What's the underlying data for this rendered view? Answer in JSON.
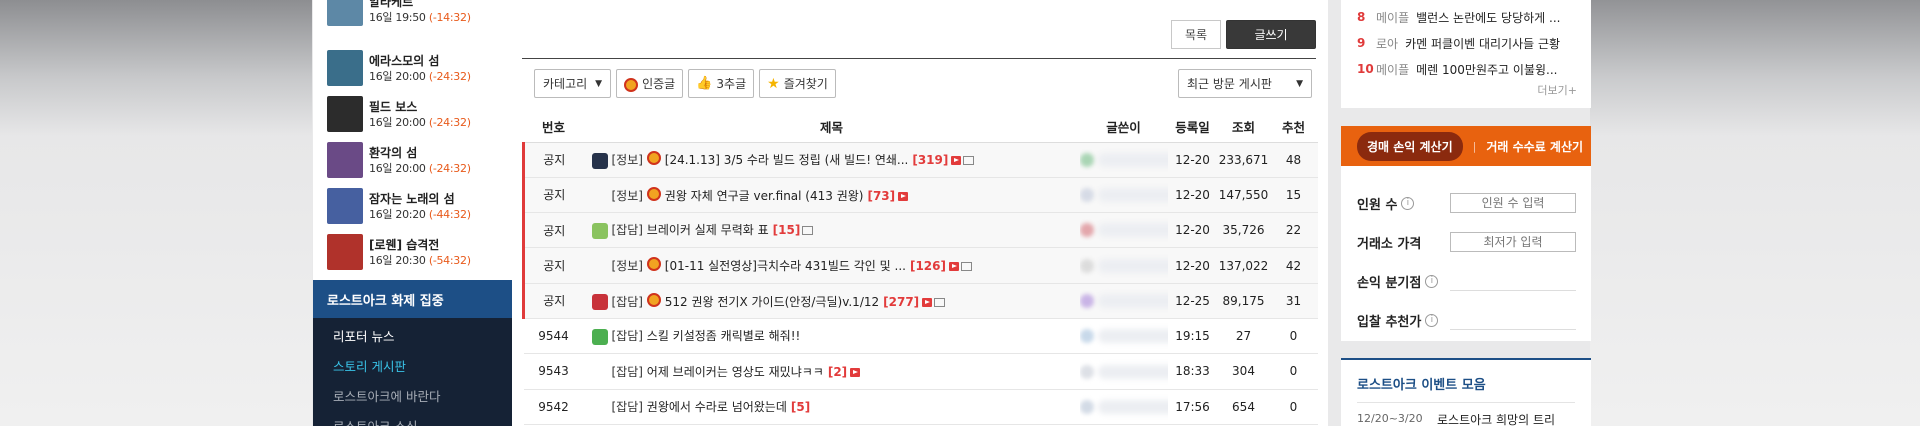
{
  "schedule": [
    {
      "title": "알라케르",
      "time": "16일 19:50",
      "diff": "(-14:32)",
      "color": "#5d88a6"
    },
    {
      "title": "에라스모의 섬",
      "time": "16일 20:00",
      "diff": "(-24:32)",
      "color": "#3a6e8a"
    },
    {
      "title": "필드 보스",
      "time": "16일 20:00",
      "diff": "(-24:32)",
      "color": "#2c2c2c"
    },
    {
      "title": "환각의 섬",
      "time": "16일 20:00",
      "diff": "(-24:32)",
      "color": "#6a4a86"
    },
    {
      "title": "잠자는 노래의 섬",
      "time": "16일 20:20",
      "diff": "(-44:32)",
      "color": "#4660a0"
    },
    {
      "title": "[로웬] 습격전",
      "time": "16일 20:30",
      "diff": "(-54:32)",
      "color": "#b0322b"
    }
  ],
  "topic": {
    "header": "로스트아크 화제 집중",
    "items": [
      "리포터 뉴스",
      "스토리 게시판",
      "로스트아크에 바란다",
      "로스트아크 소식"
    ]
  },
  "board": {
    "list_button": "목록",
    "write_button": "글쓰기",
    "category_select": "카테고리",
    "filter_certified": "인증글",
    "filter_recommend": "3추글",
    "filter_favorite": "즐겨찾기",
    "recent_select": "최근 방문 게시판",
    "columns": [
      "번호",
      "제목",
      "글쓴이",
      "등록일",
      "조회",
      "추천"
    ],
    "rows": [
      {
        "no": "공지",
        "cat": "[정보]",
        "title": "[24.1.13] 3/5 수라 빌드 정립 (새 빌드! 연쇄...",
        "comments": "[319]",
        "date": "12-20",
        "views": "233,671",
        "rec": "48",
        "notice": true,
        "icon": "#26324a",
        "medal": true,
        "vid": true,
        "img": true,
        "blur": "#a9d5b4"
      },
      {
        "no": "공지",
        "cat": "[정보]",
        "title": "권왕 자체 연구글 ver.final (413 권왕)",
        "comments": "[73]",
        "date": "12-20",
        "views": "147,550",
        "rec": "15",
        "notice": true,
        "icon": "",
        "medal": true,
        "vid": true,
        "img": false,
        "blur": "#d6dbe6"
      },
      {
        "no": "공지",
        "cat": "[잡담]",
        "title": "브레이커 실제 무력화 표",
        "comments": "[15]",
        "date": "12-20",
        "views": "35,726",
        "rec": "22",
        "notice": true,
        "icon": "#8ac35f",
        "medal": false,
        "vid": false,
        "img": true,
        "blur": "#e3a6ab"
      },
      {
        "no": "공지",
        "cat": "[정보]",
        "title": "[01-11 실전영상]극치수라 431빌드 각인 및 ...",
        "comments": "[126]",
        "date": "12-20",
        "views": "137,022",
        "rec": "42",
        "notice": true,
        "icon": "",
        "medal": true,
        "vid": true,
        "img": true,
        "blur": "#dcdcdc"
      },
      {
        "no": "공지",
        "cat": "[잡담]",
        "title": "512 권왕 전기X 가이드(안정/극딜)v.1/12",
        "comments": "[277]",
        "date": "12-25",
        "views": "89,175",
        "rec": "31",
        "notice": true,
        "icon": "#c8323a",
        "medal": true,
        "vid": true,
        "img": true,
        "blur": "#c9b4e6"
      },
      {
        "no": "9544",
        "cat": "[잡담]",
        "title": "스킬 키설정좀 캐릭별로 해줘!!",
        "comments": "",
        "date": "19:15",
        "views": "27",
        "rec": "0",
        "notice": false,
        "icon": "#4caf50",
        "medal": false,
        "vid": false,
        "img": false,
        "blur": "#c8d9ea"
      },
      {
        "no": "9543",
        "cat": "[잡담]",
        "title": "어제 브레이커는 영상도 재밌냐ㅋㅋ",
        "comments": "[2]",
        "date": "18:33",
        "views": "304",
        "rec": "0",
        "notice": false,
        "icon": "",
        "medal": false,
        "vid": true,
        "img": false,
        "blur": "#dde0e6"
      },
      {
        "no": "9542",
        "cat": "[잡담]",
        "title": "권왕에서 수라로 넘어왔는데",
        "comments": "[5]",
        "date": "17:56",
        "views": "654",
        "rec": "0",
        "notice": false,
        "icon": "",
        "medal": false,
        "vid": false,
        "img": false,
        "blur": "#d3dbe6"
      }
    ]
  },
  "issues": {
    "items": [
      {
        "rank": "8",
        "game": "메이플",
        "text": "밸런스 논란에도 당당하게 ..."
      },
      {
        "rank": "9",
        "game": "로아",
        "text": "카멘 퍼클이벤 대리기사들 근황"
      },
      {
        "rank": "10",
        "game": "메이플",
        "text": "메렌 100만원주고 이불윙..."
      }
    ],
    "more": "더보기+"
  },
  "calculator": {
    "tab_active": "경매 손익 계산기",
    "separator": "|",
    "tab_other": "거래 수수료 계산기",
    "people_label": "인원 수",
    "people_placeholder": "인원 수 입력",
    "price_label": "거래소 가격",
    "price_placeholder": "최저가 입력",
    "breakeven_label": "손익 분기점",
    "bid_label": "입찰 추천가",
    "info_glyph": "i"
  },
  "events": {
    "title": "로스트아크 이벤트 모음",
    "date": "12/20~3/20",
    "name": "로스트아크 희망의 트리"
  }
}
